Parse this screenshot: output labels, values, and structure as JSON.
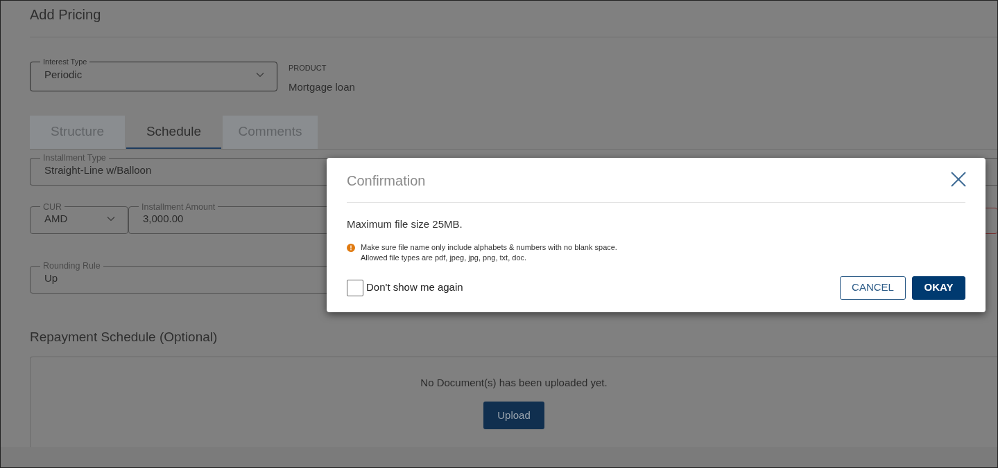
{
  "page": {
    "title": "Add Pricing"
  },
  "interest_type": {
    "label": "Interest Type",
    "value": "Periodic"
  },
  "product": {
    "label": "PRODUCT",
    "value": "Mortgage loan"
  },
  "tabs": [
    {
      "label": "Structure",
      "selected": false
    },
    {
      "label": "Schedule",
      "selected": true
    },
    {
      "label": "Comments",
      "selected": false
    }
  ],
  "installment_type": {
    "label": "Installment Type",
    "value": "Straight-Line w/Balloon"
  },
  "currency": {
    "label": "CUR",
    "value": "AMD"
  },
  "installment_amount": {
    "label": "Installment Amount",
    "value": "3,000.00"
  },
  "field_3": {
    "invalid": true
  },
  "rounding_rule": {
    "label": "Rounding Rule",
    "value": "Up"
  },
  "repayment_schedule": {
    "title": "Repayment Schedule (Optional)",
    "empty_message": "No Document(s) has been uploaded yet.",
    "upload_button": "Upload"
  },
  "dialog": {
    "title": "Confirmation",
    "message": "Maximum file size 25MB.",
    "note_lines": [
      "Make sure file name only include alphabets & numbers with no blank space.",
      "Allowed file types are pdf, jpeg, jpg, png, txt, doc."
    ],
    "checkbox": {
      "label": "Don't show me again",
      "checked": false
    },
    "buttons": [
      {
        "label": "CANCEL",
        "kind": "secondary"
      },
      {
        "label": "OKAY",
        "kind": "primary"
      }
    ]
  }
}
